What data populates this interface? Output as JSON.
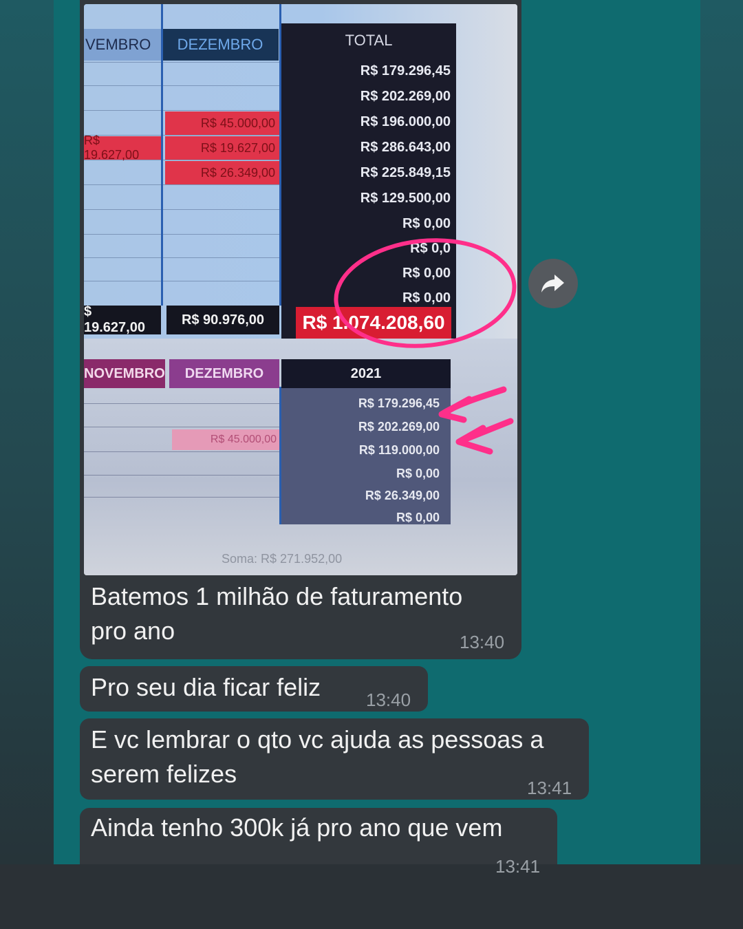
{
  "spreadsheet_photo": {
    "top_table": {
      "headers": [
        "VEMBRO",
        "DEZEMBRO",
        "TOTAL"
      ],
      "red_cells": {
        "nov": "R$ 19.627,00",
        "dez": [
          "R$ 45.000,00",
          "R$ 19.627,00",
          "R$ 26.349,00"
        ]
      },
      "totals": [
        "R$ 179.296,45",
        "R$ 202.269,00",
        "R$ 196.000,00",
        "R$ 286.643,00",
        "R$ 225.849,15",
        "R$ 129.500,00",
        "R$ 0,00",
        "R$ 0,0",
        "R$ 0,00",
        "R$ 0,00"
      ],
      "sum_row": {
        "nov": "$ 19.627,00",
        "dez": "R$ 90.976,00",
        "grand_total": "R$ 1.074.208,60"
      }
    },
    "bottom_table": {
      "headers": [
        "NOVEMBRO",
        "DEZEMBRO",
        "2021"
      ],
      "pink_cell": "R$ 45.000,00",
      "totals": [
        "R$ 179.296,45",
        "R$ 202.269,00",
        "R$ 119.000,00",
        "R$ 0,00",
        "R$ 26.349,00",
        "R$ 0,00"
      ]
    },
    "status_bar": "Soma: R$ 271.952,00"
  },
  "messages": [
    {
      "text_line1": "Batemos 1 milhão de faturamento",
      "text_line2": "pro ano",
      "time": "13:40"
    },
    {
      "text": "Pro seu dia ficar feliz",
      "time": "13:40"
    },
    {
      "text_line1": "E vc lembrar o qto vc ajuda as pessoas a",
      "text_line2": "serem felizes",
      "time": "13:41"
    },
    {
      "text": "Ainda tenho 300k já pro ano que vem",
      "time": "13:41"
    }
  ],
  "icons": {
    "forward": "forward-arrow-icon"
  },
  "colors": {
    "chat_bg": "#0f6b6f",
    "bubble": "#33383d",
    "highlight_red": "#d81d32",
    "marker_pink": "#ff2f8a"
  }
}
